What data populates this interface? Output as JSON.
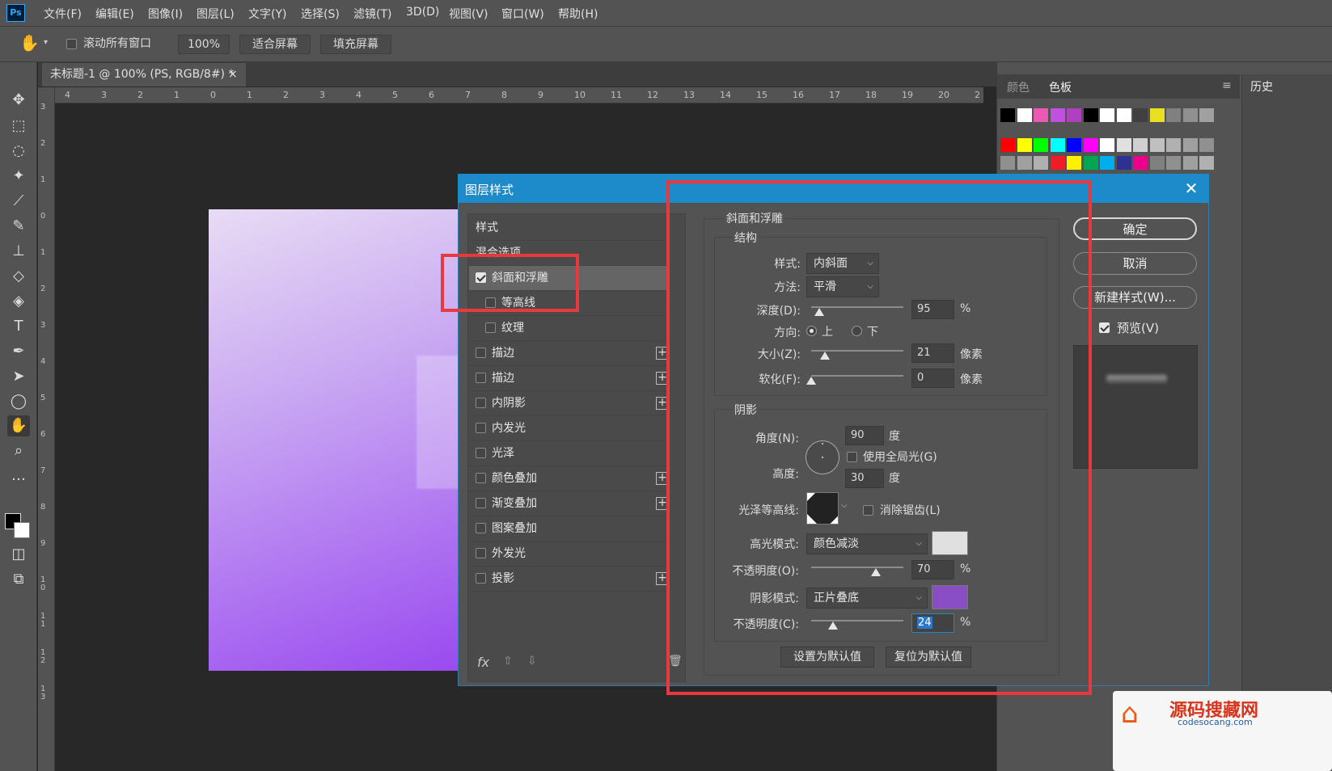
{
  "menubar": {
    "logo": "Ps",
    "items": [
      "文件(F)",
      "编辑(E)",
      "图像(I)",
      "图层(L)",
      "文字(Y)",
      "选择(S)",
      "滤镜(T)",
      "3D(D)",
      "视图(V)",
      "窗口(W)",
      "帮助(H)"
    ]
  },
  "options": {
    "scroll_all_label": "滚动所有窗口",
    "zoom_value": "100%",
    "fit_screen": "适合屏幕",
    "fill_screen": "填充屏幕"
  },
  "document": {
    "tab_title": "未标题-1 @ 100% (PS, RGB/8#) *",
    "close": "×",
    "h_ruler": [
      "4",
      "3",
      "2",
      "1",
      "0",
      "1",
      "2",
      "3",
      "4",
      "5",
      "6",
      "7",
      "8",
      "9",
      "10",
      "11",
      "12",
      "13",
      "14",
      "15",
      "16",
      "17",
      "18",
      "19",
      "20",
      "2"
    ],
    "v_ruler": [
      "3",
      "2",
      "1",
      "0",
      "1",
      "2",
      "3",
      "4",
      "5",
      "6",
      "7",
      "8",
      "9",
      "1 0",
      "1 1",
      "1 2",
      "1 3"
    ]
  },
  "panels": {
    "color_tab": "颜色",
    "swatches_tab": "色板",
    "history_tab": "历史",
    "swatch_colors_row1": [
      "#000000",
      "#ffffff",
      "#ea5ab4",
      "#c050e0",
      "#b040c0",
      "#000000",
      "#ffffff",
      "#ffffff",
      "#404040",
      "#e8e020",
      "#808080",
      "#909090",
      "#a0a0a0"
    ],
    "swatch_colors_row2": [
      "#ff0000",
      "#ffff00",
      "#00ff00",
      "#00ffff",
      "#0000ff",
      "#ff00ff",
      "#ffffff",
      "#e0e0e0",
      "#d0d0d0",
      "#c0c0c0",
      "#b0b0b0",
      "#a0a0a0",
      "#909090"
    ],
    "swatch_colors_row3": [
      "#909090",
      "#a0a0a0",
      "#b0b0b0",
      "#ee1c24",
      "#fff200",
      "#00a651",
      "#00aeef",
      "#2e3192",
      "#ec008c",
      "#808080",
      "#909090",
      "#a0a0a0",
      "#b0b0b0"
    ]
  },
  "dialog": {
    "title": "图层样式",
    "close": "✕",
    "style_list": [
      {
        "label": "样式",
        "checkbox": false,
        "checked": false,
        "plus": false,
        "sub": false
      },
      {
        "label": "混合选项",
        "checkbox": false,
        "checked": false,
        "plus": false,
        "sub": false
      },
      {
        "label": "斜面和浮雕",
        "checkbox": true,
        "checked": true,
        "plus": false,
        "sub": false,
        "selected": true
      },
      {
        "label": "等高线",
        "checkbox": true,
        "checked": false,
        "plus": false,
        "sub": true
      },
      {
        "label": "纹理",
        "checkbox": true,
        "checked": false,
        "plus": false,
        "sub": true
      },
      {
        "label": "描边",
        "checkbox": true,
        "checked": false,
        "plus": true,
        "sub": false
      },
      {
        "label": "描边",
        "checkbox": true,
        "checked": false,
        "plus": true,
        "sub": false
      },
      {
        "label": "内阴影",
        "checkbox": true,
        "checked": false,
        "plus": true,
        "sub": false
      },
      {
        "label": "内发光",
        "checkbox": true,
        "checked": false,
        "plus": false,
        "sub": false
      },
      {
        "label": "光泽",
        "checkbox": true,
        "checked": false,
        "plus": false,
        "sub": false
      },
      {
        "label": "颜色叠加",
        "checkbox": true,
        "checked": false,
        "plus": true,
        "sub": false
      },
      {
        "label": "渐变叠加",
        "checkbox": true,
        "checked": false,
        "plus": true,
        "sub": false
      },
      {
        "label": "图案叠加",
        "checkbox": true,
        "checked": false,
        "plus": false,
        "sub": false
      },
      {
        "label": "外发光",
        "checkbox": true,
        "checked": false,
        "plus": false,
        "sub": false
      },
      {
        "label": "投影",
        "checkbox": true,
        "checked": false,
        "plus": true,
        "sub": false
      }
    ],
    "fx_label": "fx",
    "bevel": {
      "section_title": "斜面和浮雕",
      "structure_title": "结构",
      "style_label": "样式:",
      "style_value": "内斜面",
      "technique_label": "方法:",
      "technique_value": "平滑",
      "depth_label": "深度(D):",
      "depth_value": "95",
      "depth_unit": "%",
      "depth_fraction": 0.09,
      "direction_label": "方向:",
      "direction_up": "上",
      "direction_down": "下",
      "size_label": "大小(Z):",
      "size_value": "21",
      "size_unit": "像素",
      "size_fraction": 0.15,
      "soften_label": "软化(F):",
      "soften_value": "0",
      "soften_unit": "像素",
      "soften_fraction": 0.0,
      "shading_title": "阴影",
      "angle_label": "角度(N):",
      "angle_value": "90",
      "angle_unit": "度",
      "global_light_label": "使用全局光(G)",
      "altitude_label": "高度:",
      "altitude_value": "30",
      "altitude_unit": "度",
      "gloss_label": "光泽等高线:",
      "antialias_label": "消除锯齿(L)",
      "highlight_mode_label": "高光模式:",
      "highlight_mode_value": "颜色减淡",
      "highlight_color": "#e0e0e0",
      "highlight_opacity_label": "不透明度(O):",
      "highlight_opacity_value": "70",
      "highlight_opacity_unit": "%",
      "highlight_opacity_fraction": 0.7,
      "shadow_mode_label": "阴影模式:",
      "shadow_mode_value": "正片叠底",
      "shadow_color": "#8a4ec4",
      "shadow_opacity_label": "不透明度(C):",
      "shadow_opacity_value": "24",
      "shadow_opacity_unit": "%",
      "shadow_opacity_fraction": 0.24,
      "make_default": "设置为默认值",
      "reset_default": "复位为默认值"
    },
    "ok": "确定",
    "cancel": "取消",
    "new_style": "新建样式(W)...",
    "preview_label": "预览(V)"
  },
  "watermark": {
    "title": "源码搜藏网",
    "url": "codesocang.com"
  },
  "accent": "#1d8bc9",
  "highlight_box_color": "#e8393f"
}
